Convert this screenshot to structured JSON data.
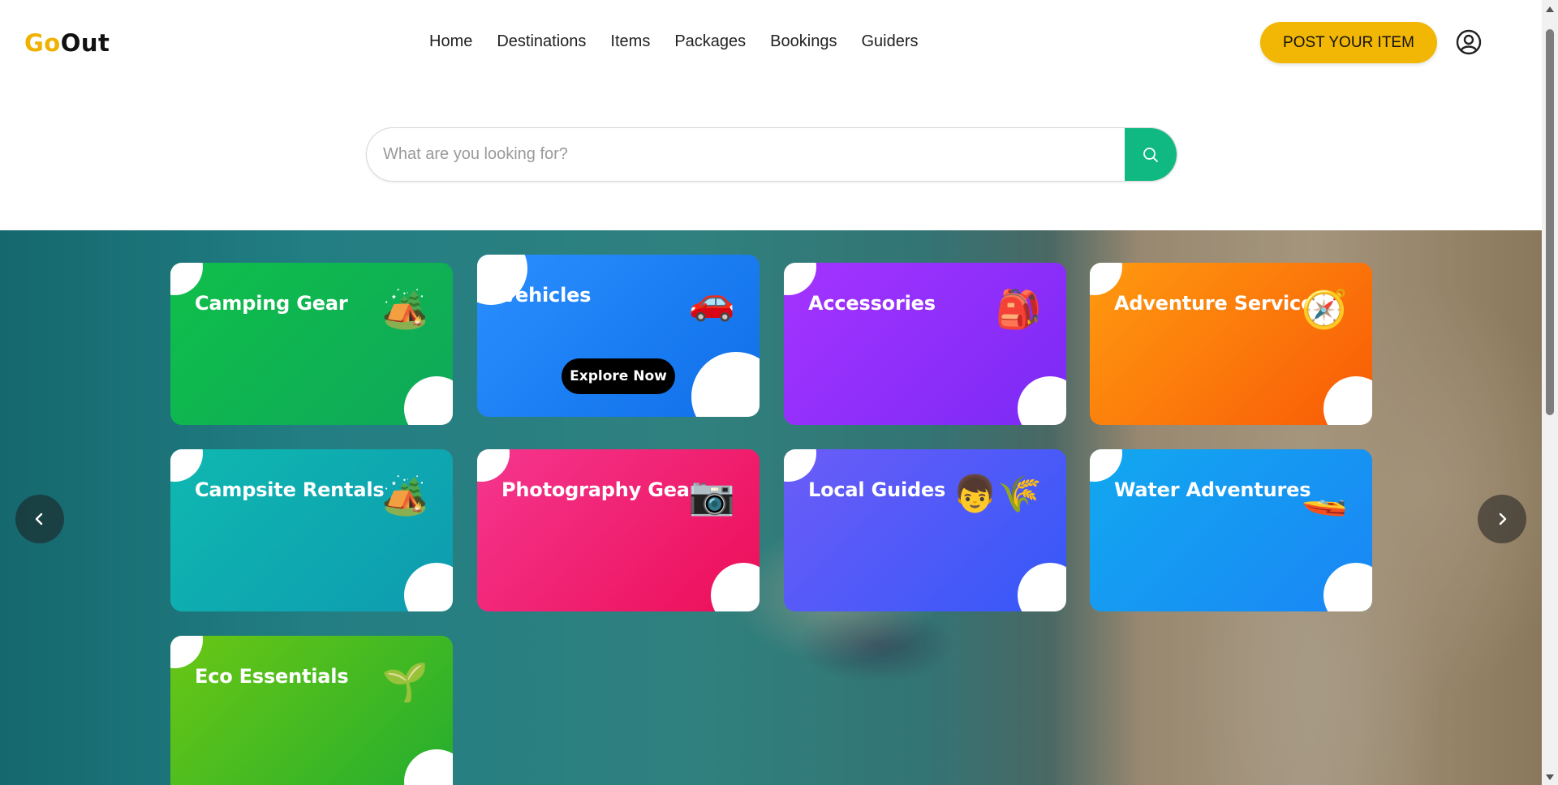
{
  "header": {
    "logo_go": "Go",
    "logo_out": "Out",
    "nav": [
      {
        "label": "Home"
      },
      {
        "label": "Destinations"
      },
      {
        "label": "Items"
      },
      {
        "label": "Packages"
      },
      {
        "label": "Bookings"
      },
      {
        "label": "Guiders"
      }
    ],
    "post_button": "POST YOUR ITEM",
    "account_icon": "user-circle-icon"
  },
  "search": {
    "placeholder": "What are you looking for?",
    "value": "",
    "icon": "search-icon"
  },
  "colors": {
    "brand_yellow": "#f2b705",
    "search_green": "#10b981"
  },
  "categories": [
    {
      "title": "Camping Gear",
      "icon": "camping-tent-emoji",
      "glyph": "🏕️"
    },
    {
      "title": "Vehicles",
      "icon": "car-emoji",
      "glyph": "🚗",
      "action": "Explore Now"
    },
    {
      "title": "Accessories",
      "icon": "backpack-emoji",
      "glyph": "🎒"
    },
    {
      "title": "Adventure Services",
      "icon": "compass-emoji",
      "glyph": "🧭"
    },
    {
      "title": "Campsite Rentals",
      "icon": "camping-tent-emoji",
      "glyph": "🏕️"
    },
    {
      "title": "Photography Gear",
      "icon": "camera-emoji",
      "glyph": "📷"
    },
    {
      "title": "Local Guides",
      "icon": "person-and-plant-emoji",
      "glyph": "👦🌾"
    },
    {
      "title": "Water Adventures",
      "icon": "speedboat-emoji",
      "glyph": "🚤"
    },
    {
      "title": "Eco Essentials",
      "icon": "seedling-emoji",
      "glyph": "🌱"
    }
  ],
  "carousel": {
    "prev_icon": "chevron-left-icon",
    "next_icon": "chevron-right-icon"
  }
}
